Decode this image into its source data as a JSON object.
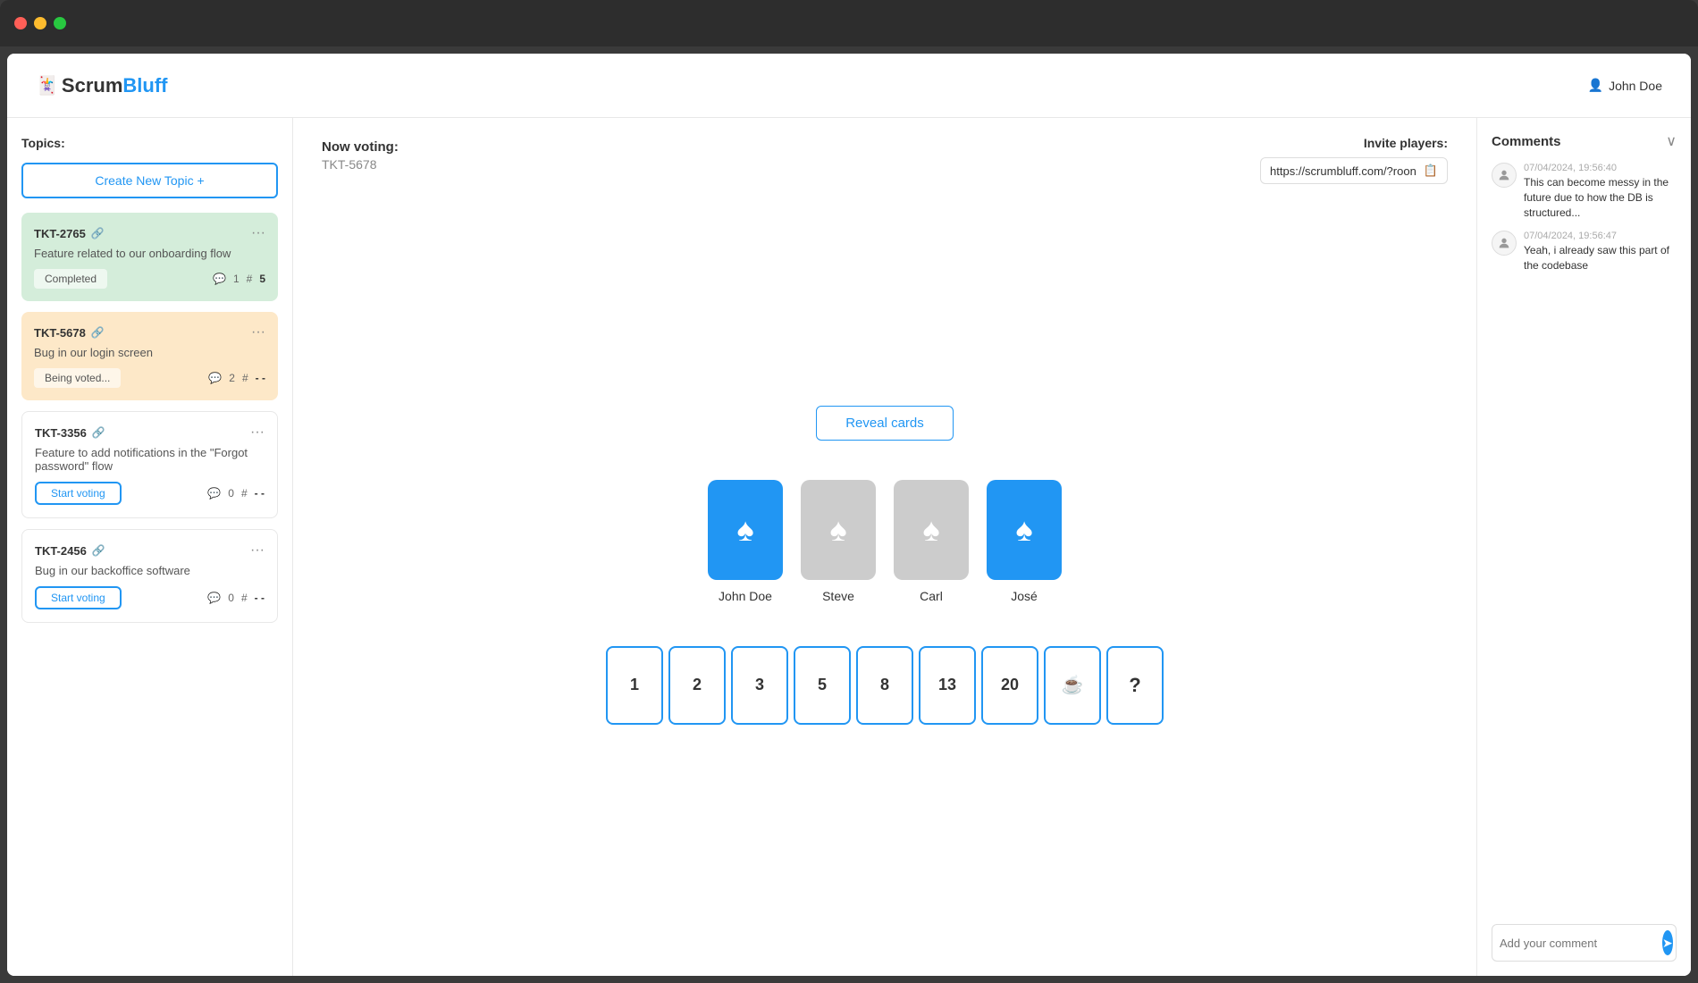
{
  "window": {
    "traffic_lights": [
      "red",
      "yellow",
      "green"
    ]
  },
  "header": {
    "logo_scrum": "Scrum",
    "logo_bluff": "Bluff",
    "logo_icon": "🃏",
    "user_icon": "👤",
    "user_name": "John Doe"
  },
  "sidebar": {
    "label": "Topics:",
    "create_btn": "Create New Topic +",
    "topics": [
      {
        "id": "TKT-2765",
        "desc": "Feature related to our onboarding flow",
        "status": "Completed",
        "comments": "1",
        "hash": "5",
        "color": "green"
      },
      {
        "id": "TKT-5678",
        "desc": "Bug in our login screen",
        "status": "Being voted...",
        "comments": "2",
        "hash": "-",
        "color": "orange"
      },
      {
        "id": "TKT-3356",
        "desc": "Feature to add notifications in the \"Forgot password\" flow",
        "status": "Start voting",
        "comments": "0",
        "hash": "-",
        "color": "white"
      },
      {
        "id": "TKT-2456",
        "desc": "Bug in our backoffice software",
        "status": "Start voting",
        "comments": "0",
        "hash": "-",
        "color": "white"
      }
    ]
  },
  "voting": {
    "now_voting_label": "Now voting:",
    "now_voting_id": "TKT-5678",
    "reveal_btn": "Reveal cards",
    "players": [
      {
        "name": "John Doe",
        "voted": true
      },
      {
        "name": "Steve",
        "voted": false
      },
      {
        "name": "Carl",
        "voted": false
      },
      {
        "name": "José",
        "voted": true
      }
    ],
    "cards": [
      "1",
      "2",
      "3",
      "5",
      "8",
      "13",
      "20",
      "☕",
      "?"
    ]
  },
  "invite": {
    "label": "Invite players:",
    "url": "https://scrumbluff.com/?roon",
    "copy_icon": "📋"
  },
  "comments": {
    "title": "Comments",
    "items": [
      {
        "time": "07/04/2024, 19:56:40",
        "text": "This can become messy in the future due to how the DB is structured..."
      },
      {
        "time": "07/04/2024, 19:56:47",
        "text": "Yeah, i already saw this part of the codebase"
      }
    ],
    "input_placeholder": "Add your comment"
  }
}
